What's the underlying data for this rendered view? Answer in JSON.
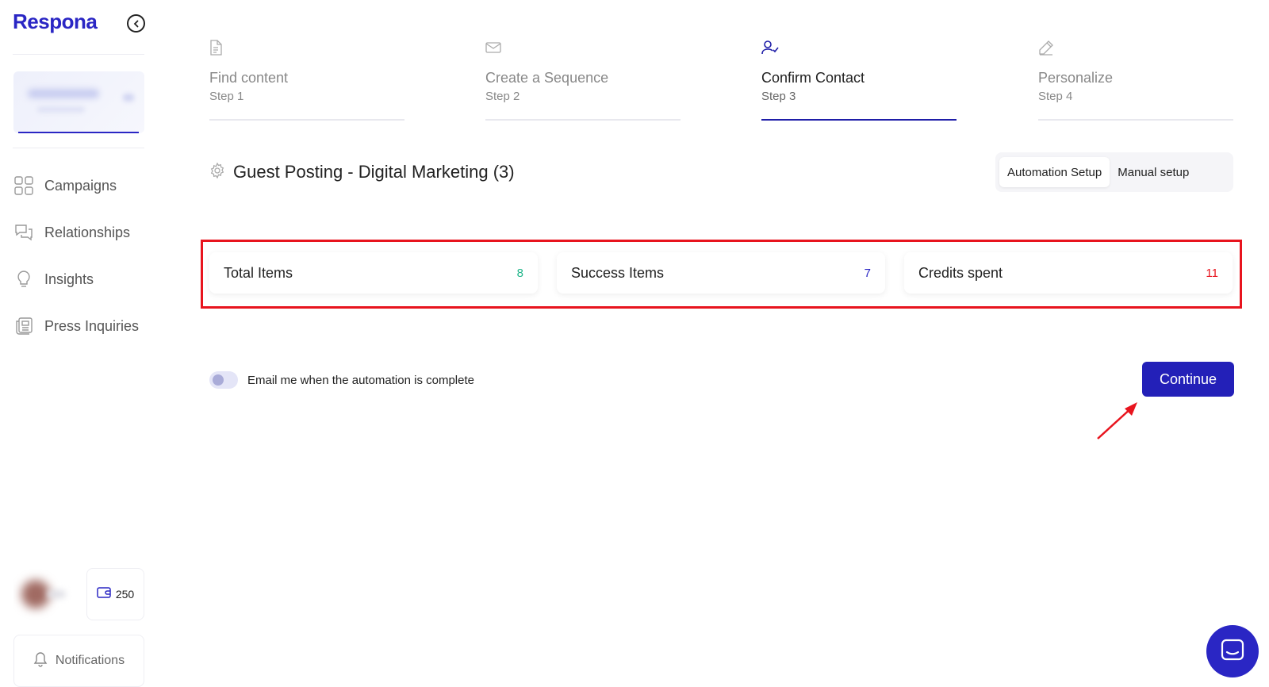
{
  "sidebar": {
    "logo": "Respona",
    "nav": [
      {
        "label": "Campaigns",
        "icon": "grid-icon"
      },
      {
        "label": "Relationships",
        "icon": "chat-bubbles-icon"
      },
      {
        "label": "Insights",
        "icon": "lightbulb-icon"
      },
      {
        "label": "Press Inquiries",
        "icon": "newspaper-icon"
      }
    ],
    "credits": "250",
    "notifications": "Notifications"
  },
  "steps": [
    {
      "title": "Find content",
      "sub": "Step 1",
      "icon": "document-icon",
      "active": false
    },
    {
      "title": "Create a Sequence",
      "sub": "Step 2",
      "icon": "mail-icon",
      "active": false
    },
    {
      "title": "Confirm Contact",
      "sub": "Step 3",
      "icon": "user-check-icon",
      "active": true
    },
    {
      "title": "Personalize",
      "sub": "Step 4",
      "icon": "pencil-icon",
      "active": false
    }
  ],
  "campaign": {
    "title": "Guest Posting - Digital Marketing (3)",
    "setup_tabs": [
      "Automation Setup",
      "Manual setup"
    ],
    "active_setup": "Automation Setup"
  },
  "stats": [
    {
      "label": "Total Items",
      "value": "8",
      "color": "#21b58a"
    },
    {
      "label": "Success Items",
      "value": "7",
      "color": "#2a26c4"
    },
    {
      "label": "Credits spent",
      "value": "11",
      "color": "#e8141e"
    }
  ],
  "email_toggle": {
    "label": "Email me when the automation is complete",
    "enabled": false
  },
  "continue_label": "Continue",
  "colors": {
    "brand": "#2a26c4",
    "button": "#2320b8",
    "highlight": "#e8141e"
  }
}
